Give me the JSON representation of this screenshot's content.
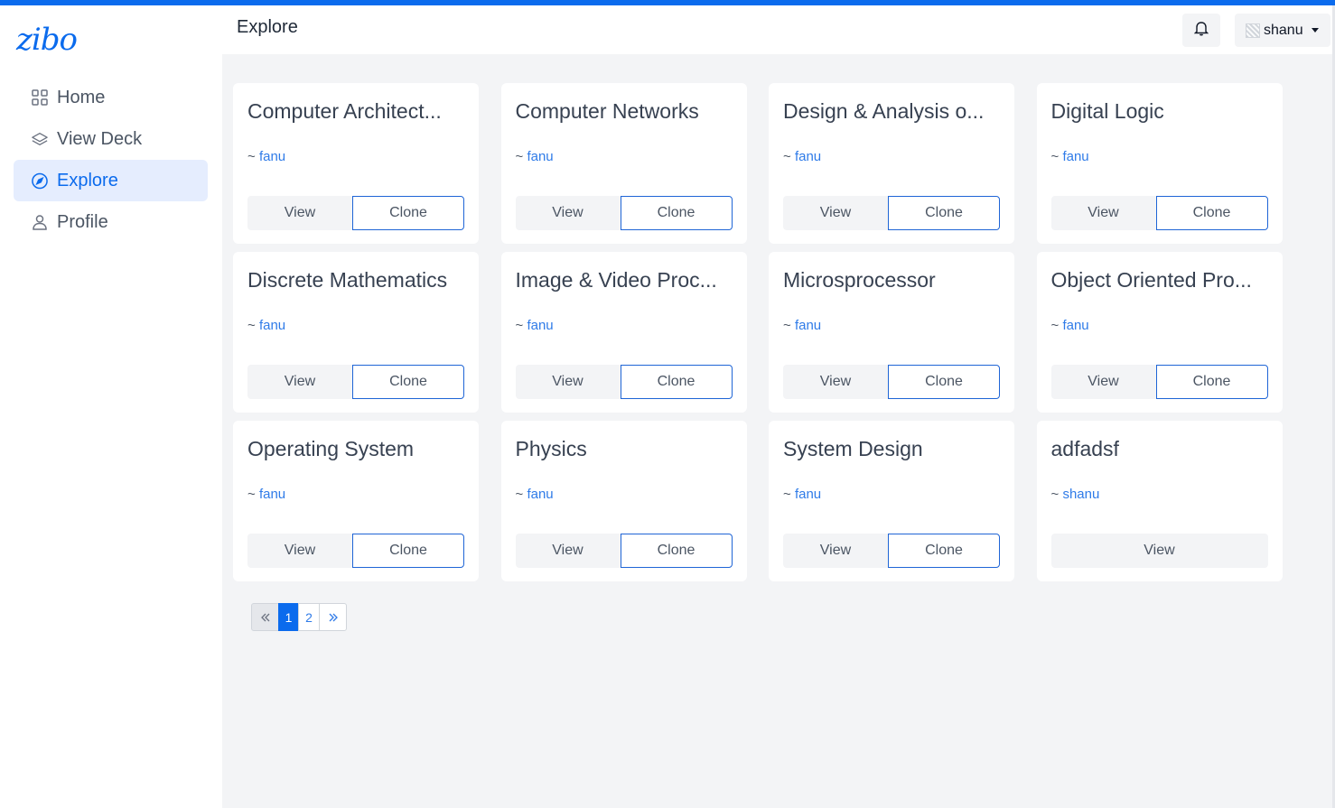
{
  "app": {
    "logo": "zibo"
  },
  "sidebar": {
    "items": [
      {
        "label": "Home",
        "icon": "grid-icon"
      },
      {
        "label": "View Deck",
        "icon": "layers-icon"
      },
      {
        "label": "Explore",
        "icon": "compass-icon",
        "active": true
      },
      {
        "label": "Profile",
        "icon": "user-icon"
      }
    ]
  },
  "header": {
    "title": "Explore",
    "notifications_icon": "bell-icon",
    "user": {
      "name": "shanu"
    }
  },
  "colors": {
    "accent": "#0b6bed",
    "link": "#2f7be8",
    "active_bg": "#e5edfe",
    "page_bg": "#f3f4f6"
  },
  "decks": [
    {
      "title": "Computer Architect...",
      "author_prefix": "~",
      "author": "fanu",
      "view": "View",
      "clone": "Clone"
    },
    {
      "title": "Computer Networks",
      "author_prefix": "~",
      "author": "fanu",
      "view": "View",
      "clone": "Clone"
    },
    {
      "title": "Design & Analysis o...",
      "author_prefix": "~",
      "author": "fanu",
      "view": "View",
      "clone": "Clone"
    },
    {
      "title": "Digital Logic",
      "author_prefix": "~",
      "author": "fanu",
      "view": "View",
      "clone": "Clone"
    },
    {
      "title": "Discrete Mathematics",
      "author_prefix": "~",
      "author": "fanu",
      "view": "View",
      "clone": "Clone"
    },
    {
      "title": "Image & Video Proc...",
      "author_prefix": "~",
      "author": "fanu",
      "view": "View",
      "clone": "Clone"
    },
    {
      "title": "Microsprocessor",
      "author_prefix": "~",
      "author": "fanu",
      "view": "View",
      "clone": "Clone"
    },
    {
      "title": "Object Oriented Pro...",
      "author_prefix": "~",
      "author": "fanu",
      "view": "View",
      "clone": "Clone"
    },
    {
      "title": "Operating System",
      "author_prefix": "~",
      "author": "fanu",
      "view": "View",
      "clone": "Clone"
    },
    {
      "title": "Physics",
      "author_prefix": "~",
      "author": "fanu",
      "view": "View",
      "clone": "Clone"
    },
    {
      "title": "System Design",
      "author_prefix": "~",
      "author": "fanu",
      "view": "View",
      "clone": "Clone"
    },
    {
      "title": "adfadsf",
      "author_prefix": "~",
      "author": "shanu",
      "view": "View",
      "clone": null
    }
  ],
  "pagination": {
    "prev": "«",
    "pages": [
      "1",
      "2"
    ],
    "current": "1",
    "next": "»"
  }
}
